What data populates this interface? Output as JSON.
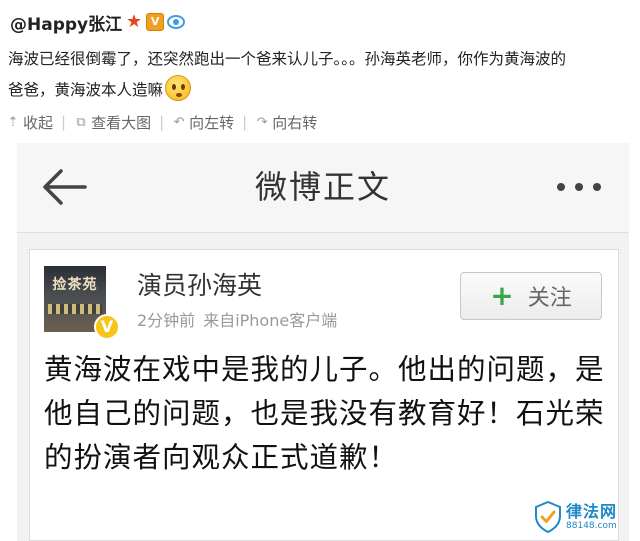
{
  "top_post": {
    "poster_name": "@Happy张江",
    "text_line1": "海波已经很倒霉了，还突然跑出一个爸来认儿子。。。孙海英老师，你作为黄海波的",
    "text_line2": "爸爸，黄海波本人造嘛",
    "emoji": "embarrassed-emoji"
  },
  "actions": [
    {
      "icon": "collapse-up-icon",
      "label": "收起"
    },
    {
      "icon": "view-image-icon",
      "label": "查看大图"
    },
    {
      "icon": "rotate-left-icon",
      "label": "向左转"
    },
    {
      "icon": "rotate-right-icon",
      "label": "向右转"
    }
  ],
  "screenshot": {
    "nav_title": "微博正文",
    "author": "演员孙海英",
    "avatar_sign": "捡茶苑",
    "verified_badge": "V",
    "time": "2分钟前",
    "source": "来自iPhone客户端",
    "follow_label": "关注",
    "body": "黄海波在戏中是我的儿子。他出的问题，是他自己的问题，也是我没有教育好！石光荣的扮演者向观众正式道歉！"
  },
  "watermark": {
    "title": "律法网",
    "url": "88148.com"
  },
  "colors": {
    "accent_blue": "#1e88c8",
    "follow_green": "#3aa54a",
    "verified_yellow": "#f5c518"
  }
}
